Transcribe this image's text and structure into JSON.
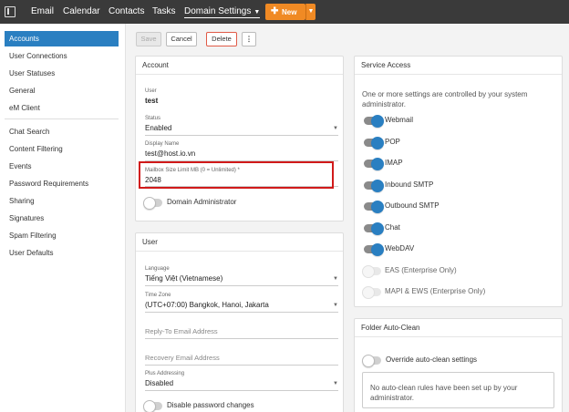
{
  "nav": {
    "items": [
      {
        "label": "Email"
      },
      {
        "label": "Calendar"
      },
      {
        "label": "Contacts"
      },
      {
        "label": "Tasks"
      },
      {
        "label": "Domain Settings"
      }
    ],
    "new_label": "New"
  },
  "sidebar": {
    "group1": [
      "Accounts",
      "User Connections",
      "User Statuses",
      "General",
      "eM Client"
    ],
    "group2": [
      "Chat Search",
      "Content Filtering",
      "Events",
      "Password Requirements",
      "Sharing",
      "Signatures",
      "Spam Filtering",
      "User Defaults"
    ]
  },
  "toolbar": {
    "save": "Save",
    "cancel": "Cancel",
    "delete": "Delete",
    "more": "⋮"
  },
  "account": {
    "title": "Account",
    "user_label": "User",
    "user_value": "test",
    "status_label": "Status",
    "status_value": "Enabled",
    "display_name_label": "Display Name",
    "display_name_value": "test@host.io.vn",
    "mailbox_label": "Mailbox Size Limit MB (0 = Unlimited) *",
    "mailbox_value": "2048",
    "domain_admin_label": "Domain Administrator"
  },
  "user": {
    "title": "User",
    "language_label": "Language",
    "language_value": "Tiếng Việt (Vietnamese)",
    "timezone_label": "Time Zone",
    "timezone_value": "(UTC+07:00) Bangkok, Hanoi, Jakarta",
    "reply_to_placeholder": "Reply-To Email Address",
    "recovery_placeholder": "Recovery Email Address",
    "plus_label": "Plus Addressing",
    "plus_value": "Disabled",
    "disable_pw_label": "Disable password changes"
  },
  "service_access": {
    "title": "Service Access",
    "notice": "One or more settings are controlled by your system administrator.",
    "services": [
      {
        "label": "Webmail",
        "state": "on"
      },
      {
        "label": "POP",
        "state": "on"
      },
      {
        "label": "IMAP",
        "state": "on"
      },
      {
        "label": "Inbound SMTP",
        "state": "on"
      },
      {
        "label": "Outbound SMTP",
        "state": "on"
      },
      {
        "label": "Chat",
        "state": "on"
      },
      {
        "label": "WebDAV",
        "state": "on"
      },
      {
        "label": "EAS (Enterprise Only)",
        "state": "disabled"
      },
      {
        "label": "MAPI & EWS (Enterprise Only)",
        "state": "disabled"
      }
    ]
  },
  "auto_clean": {
    "title": "Folder Auto-Clean",
    "override_label": "Override auto-clean settings",
    "empty_text": "No auto-clean rules have been set up by your administrator."
  },
  "colors": {
    "accent": "#2a7fc1",
    "new_button": "#f08a24",
    "topbar": "#3a3a3a",
    "highlight": "#d11a1a"
  }
}
